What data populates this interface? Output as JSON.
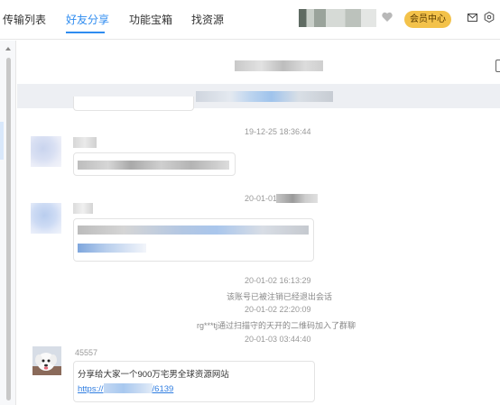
{
  "nav": {
    "tabs": [
      {
        "label": "传输列表",
        "active": false
      },
      {
        "label": "好友分享",
        "active": true
      },
      {
        "label": "功能宝箱",
        "active": false
      },
      {
        "label": "找资源",
        "active": false
      }
    ],
    "vip_label": "会员中心",
    "accent_color": "#2f8cf0",
    "vip_color": "#f3c24a"
  },
  "chat": {
    "messages": {
      "time1": "19-12-25  18:36:44",
      "time2": "20-01-01",
      "time3": "20-01-02  16:13:29",
      "sys1": "该账号已被注销已经退出会话",
      "time4": "20-01-02  22:20:09",
      "sys2": "rg***tj通过扫描守的天开的二维码加入了群聊",
      "time5": "20-01-03  03:44:40",
      "sender": "45557",
      "text": "分享给大家一个900万宅男全球资源网站",
      "link_prefix": "https://",
      "link_suffix": "/6139"
    }
  },
  "icons": [
    "heart-icon",
    "mail-icon",
    "settings-icon",
    "scroll-up-icon",
    "panel-icon"
  ]
}
